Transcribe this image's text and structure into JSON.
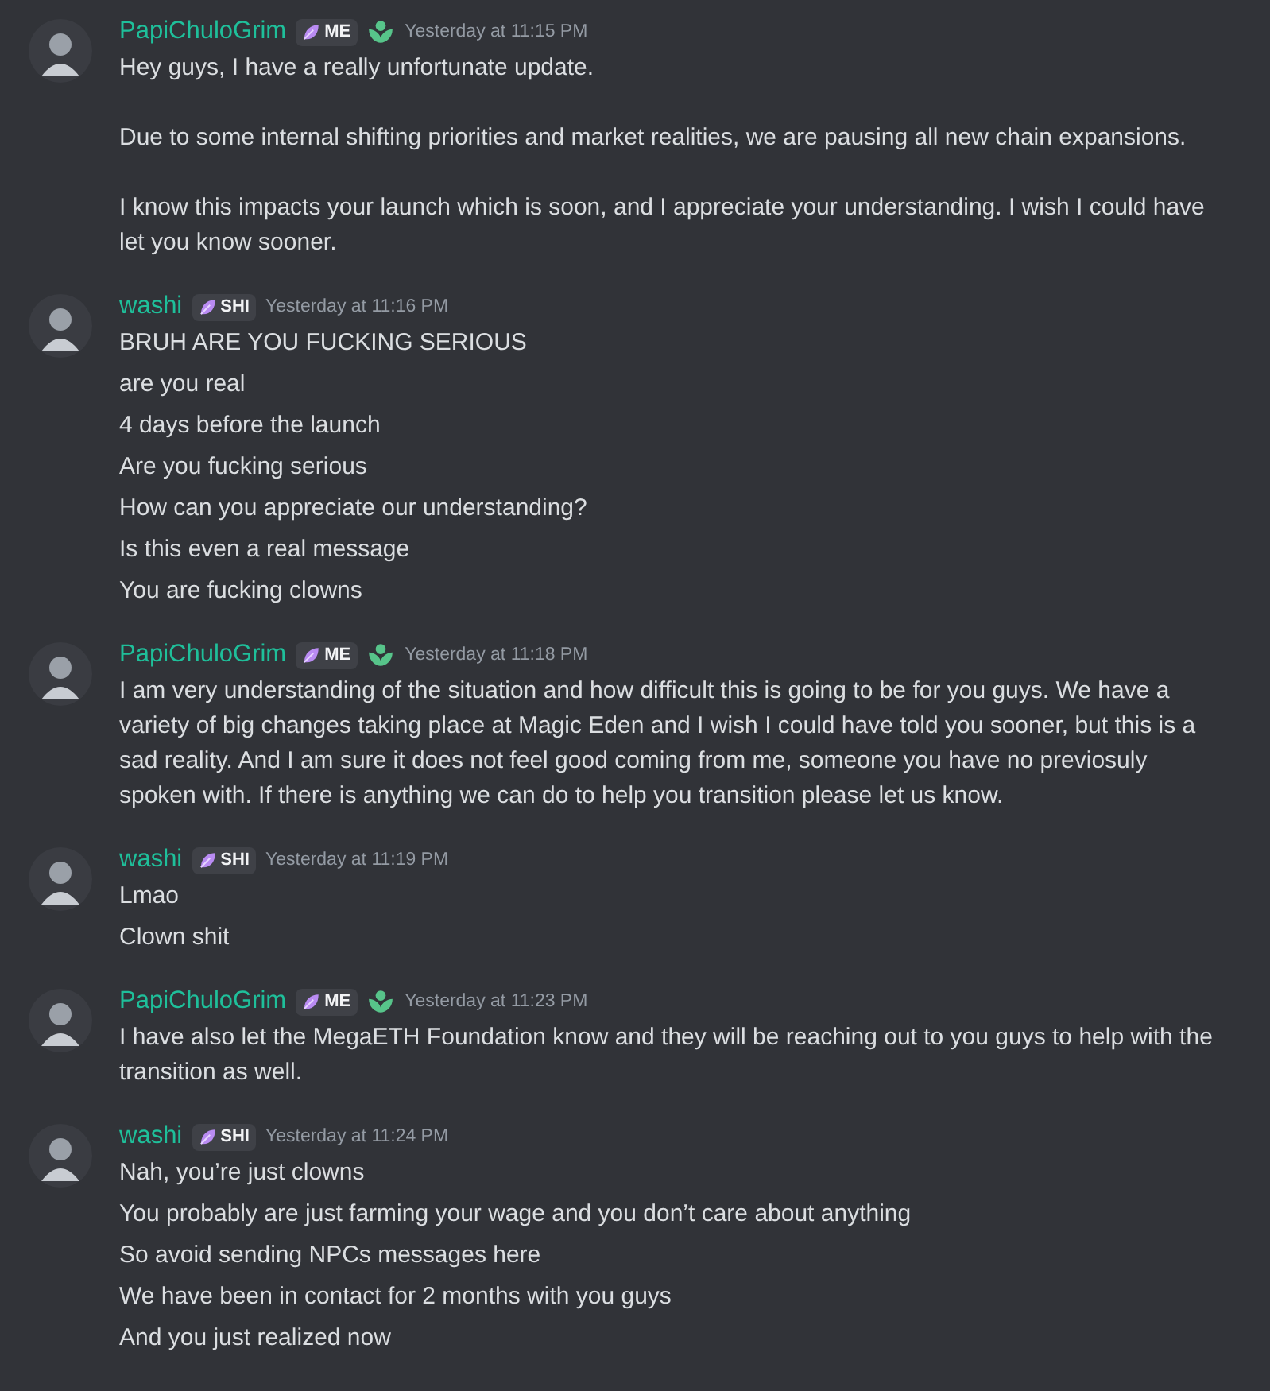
{
  "messages": [
    {
      "author": "PapiChuloGrim",
      "tag": "ME",
      "role_icon": true,
      "timestamp": "Yesterday at 11:15 PM",
      "kind": "paragraphs",
      "lines": [
        "Hey guys, I have a really unfortunate update.",
        "Due to some internal shifting priorities and market realities, we are pausing all new chain expansions.",
        "I know this impacts your launch which is soon, and I appreciate your understanding. I wish I could have let you know sooner."
      ]
    },
    {
      "author": "washi",
      "tag": "SHI",
      "role_icon": false,
      "timestamp": "Yesterday at 11:16 PM",
      "kind": "lines",
      "lines": [
        "BRUH ARE YOU FUCKING SERIOUS",
        "are you real",
        "4 days before the launch",
        "Are you fucking serious",
        "How can you appreciate our understanding?",
        "Is this even a real message",
        "You are fucking clowns"
      ]
    },
    {
      "author": "PapiChuloGrim",
      "tag": "ME",
      "role_icon": true,
      "timestamp": "Yesterday at 11:18 PM",
      "kind": "paragraphs",
      "lines": [
        "I am very understanding of the situation and how difficult this is going to be for you guys. We have a variety of big changes taking place at Magic Eden and I wish I could have told you sooner, but this is a sad reality. And I am sure it does not feel good coming from me, someone you have no previosuly spoken with. If there is anything we can do to help you transition please let us know."
      ]
    },
    {
      "author": "washi",
      "tag": "SHI",
      "role_icon": false,
      "timestamp": "Yesterday at 11:19 PM",
      "kind": "lines",
      "lines": [
        "Lmao",
        "Clown shit"
      ]
    },
    {
      "author": "PapiChuloGrim",
      "tag": "ME",
      "role_icon": true,
      "timestamp": "Yesterday at 11:23 PM",
      "kind": "paragraphs",
      "lines": [
        "I have also let the MegaETH Foundation know and they will be reaching out to you guys to help with the transition as well."
      ]
    },
    {
      "author": "washi",
      "tag": "SHI",
      "role_icon": false,
      "timestamp": "Yesterday at 11:24 PM",
      "kind": "lines",
      "lines": [
        "Nah, you’re just clowns",
        "You probably are just farming your wage and you don’t care about anything",
        "So avoid sending NPCs messages here",
        "We have been in contact for 2 months with you guys",
        "And you just realized now"
      ]
    }
  ]
}
